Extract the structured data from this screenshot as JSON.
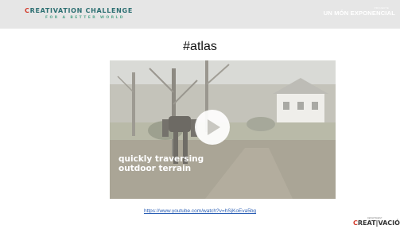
{
  "header": {
    "brand_first_letter": "C",
    "brand_rest": "REATIVATION CHALLENGE",
    "brand_subtitle": "FOR A BETTER WORLD",
    "tagline_small": "PROJECTE",
    "tagline": "UN MÓN EXPONENCIAL"
  },
  "slide": {
    "title": "#atlas"
  },
  "video": {
    "caption_line1": "quickly traversing",
    "caption_line2": "outdoor terrain",
    "play_icon": "play-icon"
  },
  "link": {
    "url": "https://www.youtube.com/watch?v=hSjKoEva5bg"
  },
  "footer_logo": {
    "small_text": "DEPARTAMENT",
    "first_letter": "C",
    "rest": "REAT|VACIÓ"
  },
  "colors": {
    "header_bg": "#e6e6e6",
    "brand_teal": "#2d6f72",
    "brand_red": "#d23a2a",
    "link_blue": "#2b5fb5"
  }
}
